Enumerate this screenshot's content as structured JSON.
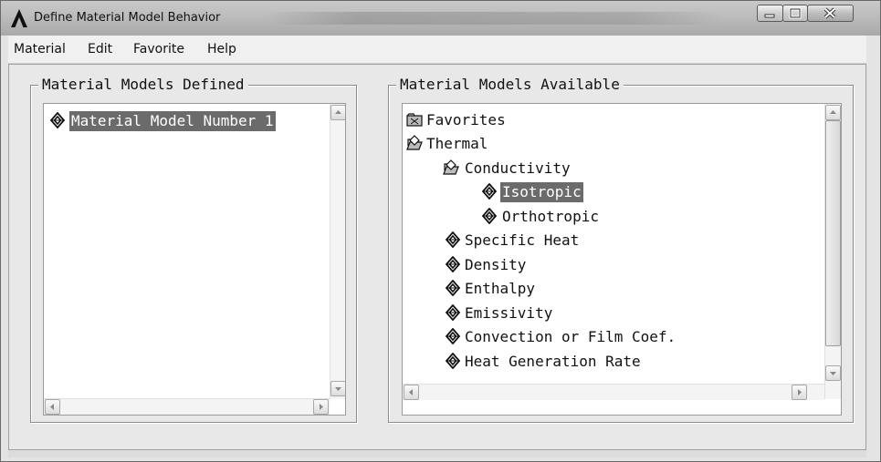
{
  "window": {
    "title": "Define Material Model Behavior",
    "controls": [
      "minimize-icon",
      "maximize-icon",
      "close-icon"
    ]
  },
  "menubar": {
    "items": [
      "Material",
      "Edit",
      "Favorite",
      "Help"
    ]
  },
  "defined": {
    "title": "Material Models Defined",
    "items": [
      {
        "label": "Material Model Number 1",
        "icon": "material-icon",
        "selected": true
      }
    ]
  },
  "available": {
    "title": "Material Models Available",
    "items": [
      {
        "label": "Favorites",
        "icon": "folder-closed-icon",
        "level": 0
      },
      {
        "label": "Thermal",
        "icon": "folder-open-icon",
        "level": 0
      },
      {
        "label": "Conductivity",
        "icon": "folder-open-icon",
        "level": 1
      },
      {
        "label": "Isotropic",
        "icon": "material-icon",
        "level": 2,
        "selected": true
      },
      {
        "label": "Orthotropic",
        "icon": "material-icon",
        "level": 2
      },
      {
        "label": "Specific Heat",
        "icon": "material-icon",
        "level": 1
      },
      {
        "label": "Density",
        "icon": "material-icon",
        "level": 1
      },
      {
        "label": "Enthalpy",
        "icon": "material-icon",
        "level": 1
      },
      {
        "label": "Emissivity",
        "icon": "material-icon",
        "level": 1
      },
      {
        "label": "Convection or Film Coef.",
        "icon": "material-icon",
        "level": 1
      },
      {
        "label": "Heat Generation Rate",
        "icon": "material-icon",
        "level": 1
      }
    ]
  },
  "colors": {
    "selection": "#6b6b6b",
    "list_background": "#ffffff",
    "client_background": "#e8e8e8"
  }
}
